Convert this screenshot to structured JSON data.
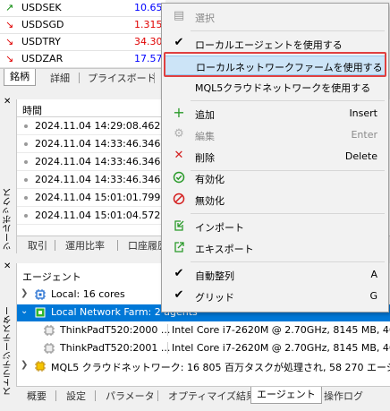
{
  "market_watch": {
    "rows": [
      {
        "symbol": "USDSEK",
        "value": "10.655",
        "dir": "up",
        "color": "#0000ff"
      },
      {
        "symbol": "USDSGD",
        "value": "1.315",
        "dir": "down",
        "color": "#e00000"
      },
      {
        "symbol": "USDTRY",
        "value": "34.309",
        "dir": "down",
        "color": "#e00000"
      },
      {
        "symbol": "USDZAR",
        "value": "17.57",
        "dir": "down",
        "color": "#0000ff"
      }
    ],
    "tabs": [
      "銘柄",
      "詳細",
      "プライスボード",
      "テ"
    ]
  },
  "toolbox": {
    "label": "ツールボックス",
    "journal_header": "時間",
    "journal_rows": [
      "2024.11.04 14:29:08.462",
      "2024.11.04 14:33:46.346",
      "2024.11.04 14:33:46.346",
      "2024.11.04 14:33:46.346",
      "2024.11.04 15:01:01.799",
      "2024.11.04 15:01:04.572"
    ],
    "tabs": [
      "取引",
      "運用比率",
      "口座履歴"
    ]
  },
  "tester": {
    "label": "ストラテジーテスター",
    "header": "エージェント",
    "rows": [
      {
        "name": "Local: 16 cores",
        "level": 0,
        "expand": ">",
        "icon": "cpu-icon",
        "selected": false
      },
      {
        "name": "Local Network Farm: 2 agents",
        "level": 0,
        "expand": "v",
        "icon": "farm-icon",
        "selected": true
      },
      {
        "name": "ThinkPadT520:2000 ...",
        "detail": "Intel Core i7-2620M  @ 2.70GHz, 8145 MB, 4648",
        "level": 1,
        "selected": false
      },
      {
        "name": "ThinkPadT520:2001 ...",
        "detail": "Intel Core i7-2620M  @ 2.70GHz, 8145 MB, 4648",
        "level": 1,
        "selected": false
      },
      {
        "name": "MQL5 クラウドネットワーク: 16 805 百万タスクが処理され, 58 270 エージェントが利用",
        "level": 0,
        "expand": ">",
        "icon": "cloud-icon",
        "selected": false
      }
    ],
    "tabs": [
      "概要",
      "設定",
      "パラメータ",
      "オプティマイズ結果",
      "エージェント",
      "操作ログ"
    ],
    "active_tab": "エージェント"
  },
  "context_menu": {
    "items": [
      {
        "label": "選択",
        "icon": "select-icon",
        "shortcut": "",
        "disabled": true
      },
      {
        "label": "ローカルエージェントを使用する",
        "icon": "check-icon",
        "shortcut": "",
        "disabled": false
      },
      {
        "label": "ローカルネットワークファームを使用する",
        "icon": "",
        "shortcut": "",
        "disabled": false,
        "highlighted": true
      },
      {
        "label": "MQL5クラウドネットワークを使用する",
        "icon": "",
        "shortcut": "",
        "disabled": false
      },
      {
        "label": "追加",
        "icon": "plus-icon",
        "shortcut": "Insert",
        "disabled": false
      },
      {
        "label": "編集",
        "icon": "gear-icon",
        "shortcut": "Enter",
        "disabled": true
      },
      {
        "label": "削除",
        "icon": "delete-icon",
        "shortcut": "Delete",
        "disabled": false
      },
      {
        "label": "有効化",
        "icon": "enable-icon",
        "shortcut": "",
        "disabled": false
      },
      {
        "label": "無効化",
        "icon": "disable-icon",
        "shortcut": "",
        "disabled": false
      },
      {
        "label": "インポート",
        "icon": "import-icon",
        "shortcut": "",
        "disabled": false
      },
      {
        "label": "エキスポート",
        "icon": "export-icon",
        "shortcut": "",
        "disabled": false
      },
      {
        "label": "自動整列",
        "icon": "check-icon",
        "shortcut": "A",
        "disabled": false
      },
      {
        "label": "グリッド",
        "icon": "check-icon",
        "shortcut": "G",
        "disabled": false
      }
    ]
  },
  "colors": {
    "accent": "#0078d7",
    "highlight_box": "#e04040",
    "menu_hover": "#cce4f7"
  }
}
